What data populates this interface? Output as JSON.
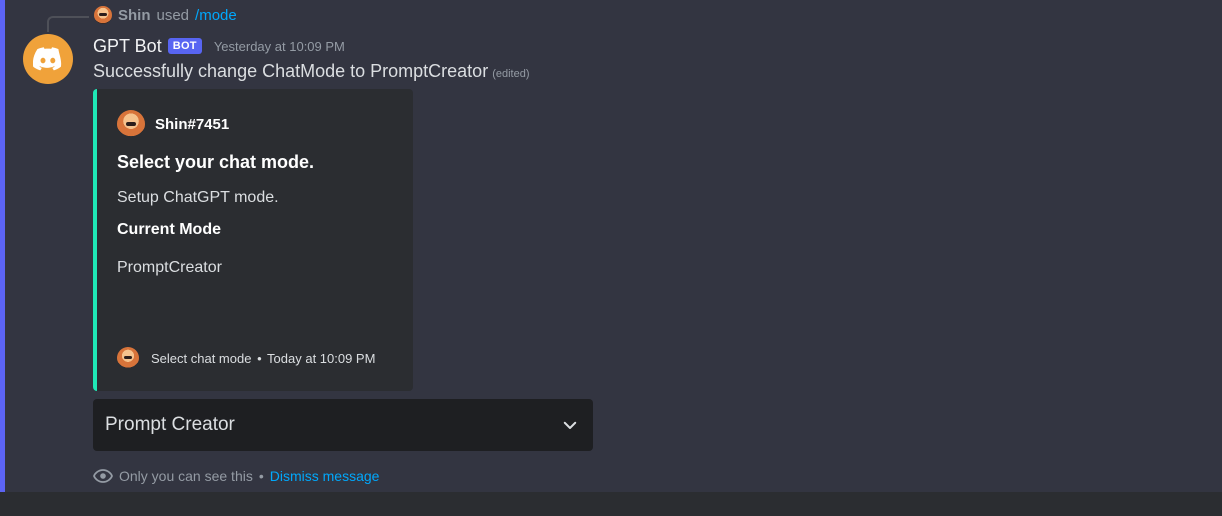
{
  "reply": {
    "user": "Shin",
    "used_text": "used",
    "command": "/mode"
  },
  "message": {
    "bot_name": "GPT Bot",
    "bot_tag": "BOT",
    "timestamp": "Yesterday at 10:09 PM",
    "content": "Successfully change ChatMode to PromptCreator",
    "edited": "(edited)"
  },
  "embed": {
    "author": "Shin#7451",
    "title": "Select your chat mode.",
    "description": "Setup ChatGPT mode.",
    "field_name": "Current Mode",
    "field_value": "PromptCreator",
    "footer_text": "Select chat mode",
    "footer_separator": "•",
    "footer_time": "Today at 10:09 PM",
    "accent_color": "#1fe8b6"
  },
  "select": {
    "value": "Prompt Creator"
  },
  "ephemeral": {
    "notice": "Only you can see this",
    "separator": "•",
    "dismiss": "Dismiss message"
  },
  "icons": {
    "bot_avatar": "discord-logo-icon",
    "select": "chevron-down-icon",
    "ephemeral": "eye-icon"
  }
}
